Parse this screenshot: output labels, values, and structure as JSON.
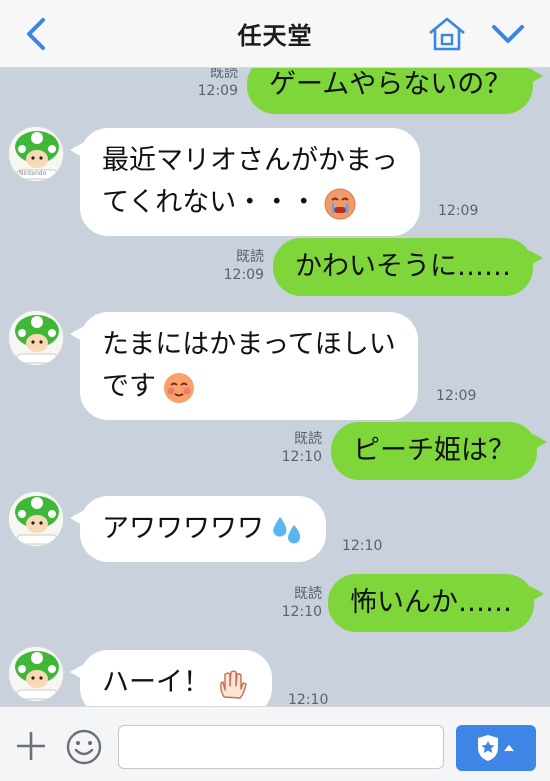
{
  "header": {
    "title": "任天堂",
    "back_icon": "chevron-left-icon",
    "home_icon": "home-icon",
    "menu_icon": "chevron-down-icon",
    "accent_color": "#3a86e2"
  },
  "colors": {
    "chat_background": "#c9d1dd",
    "outgoing_bubble": "#7fd63a",
    "incoming_bubble": "#ffffff",
    "send_button": "#3f85e6"
  },
  "messages": [
    {
      "direction": "out",
      "text": "ゲームやらないの？",
      "read": "既読",
      "time": "12:09"
    },
    {
      "direction": "in",
      "line1": "最近マリオさんがかまっ",
      "line2": "てくれない・・・",
      "emoji": "crying-face-icon",
      "time": "12:09"
    },
    {
      "direction": "out",
      "text": "かわいそうに……",
      "read": "既読",
      "time": "12:09"
    },
    {
      "direction": "in",
      "line1": "たまにはかまってほしい",
      "line2": "です",
      "emoji": "blushing-face-icon",
      "time": "12:09"
    },
    {
      "direction": "out",
      "text": "ピーチ姫は？",
      "read": "既読",
      "time": "12:10"
    },
    {
      "direction": "in",
      "line1": "アワワワワワ",
      "emoji": "sweat-drops-icon",
      "time": "12:10"
    },
    {
      "direction": "out",
      "text": "怖いんか……",
      "read": "既読",
      "time": "12:10"
    },
    {
      "direction": "in",
      "line1": "ハーイ！",
      "emoji": "raised-hand-icon",
      "time": "12:10"
    }
  ],
  "avatar": {
    "label": "Nintendo"
  },
  "input": {
    "placeholder": "",
    "plus_icon": "plus-icon",
    "sticker_icon": "smiley-icon",
    "send_icon": "shield-star-icon"
  }
}
